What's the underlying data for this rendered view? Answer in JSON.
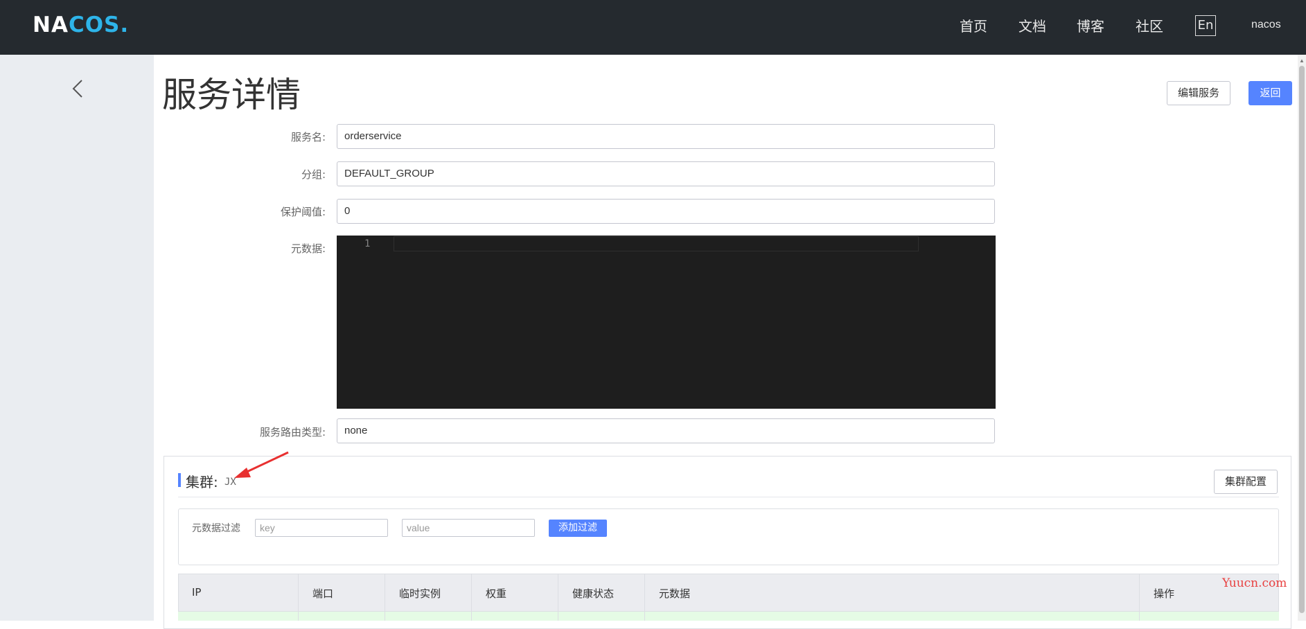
{
  "header": {
    "logo": {
      "part1": "NA",
      "part2": "COS",
      "part3": "."
    },
    "nav": [
      "首页",
      "文档",
      "博客",
      "社区"
    ],
    "lang": "En",
    "user": "nacos"
  },
  "page": {
    "title": "服务详情",
    "edit_button": "编辑服务",
    "back_button": "返回"
  },
  "form": {
    "service_name_label": "服务名:",
    "service_name_value": "orderservice",
    "group_label": "分组:",
    "group_value": "DEFAULT_GROUP",
    "threshold_label": "保护阈值:",
    "threshold_value": "0",
    "metadata_label": "元数据:",
    "metadata_line_number": "1",
    "selector_label": "服务路由类型:",
    "selector_value": "none"
  },
  "cluster": {
    "title": "集群:",
    "name": "JX",
    "config_button": "集群配置",
    "filter_label": "元数据过滤",
    "key_placeholder": "key",
    "value_placeholder": "value",
    "add_filter_button": "添加过滤"
  },
  "table": {
    "columns": [
      "IP",
      "端口",
      "临时实例",
      "权重",
      "健康状态",
      "元数据",
      "操作"
    ]
  },
  "watermark": "Yuucn.com",
  "colors": {
    "header_bg": "#252a2f",
    "primary": "#5584ff",
    "sidebar_bg": "#eaedf1",
    "editor_bg": "#1e1e1e",
    "row_healthy_bg": "#e5fbe5",
    "annotation": "#e83030"
  }
}
